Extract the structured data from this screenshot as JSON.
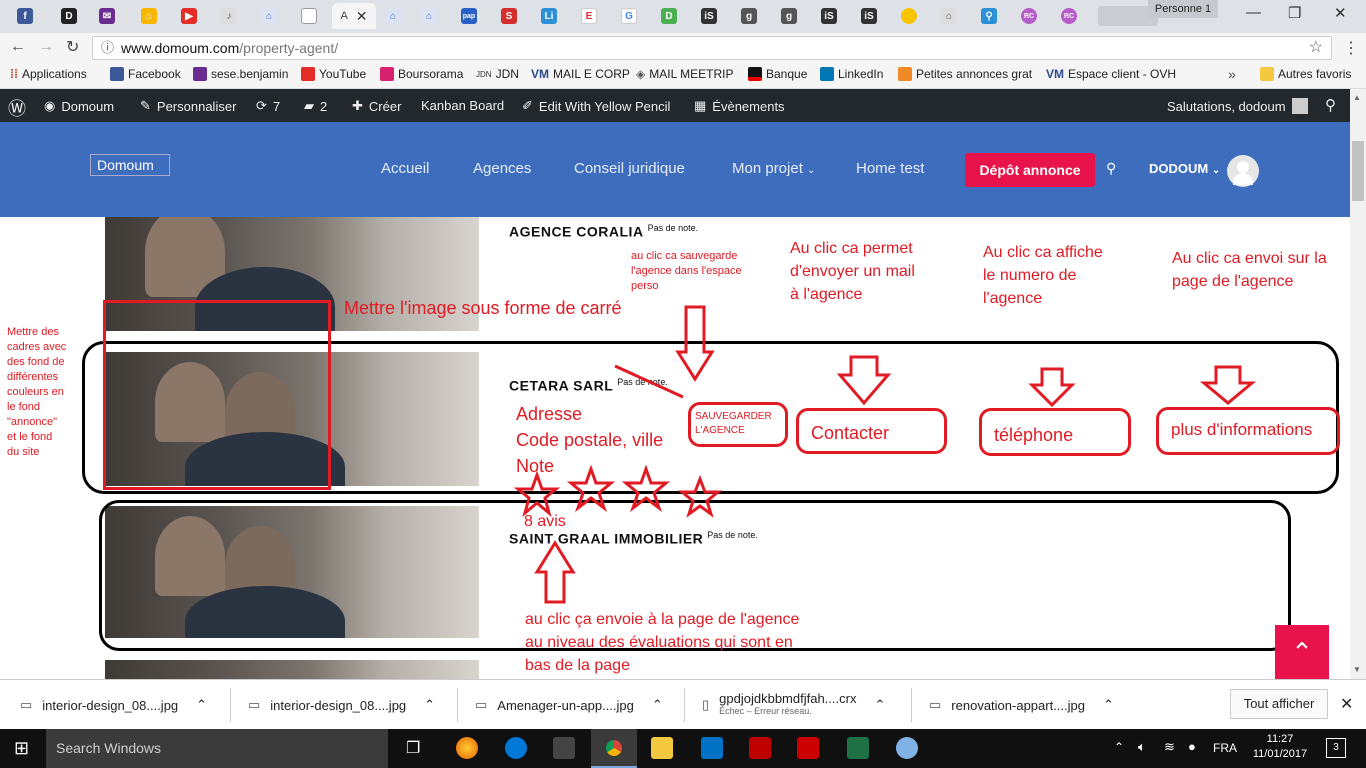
{
  "browser": {
    "profile": "Personne 1",
    "url_host": "www.domoum.com",
    "url_path": "/property-agent/",
    "active_tab_label": "A"
  },
  "bookmarks": [
    "Applications",
    "Facebook",
    "sese.benjamin",
    "YouTube",
    "Boursorama",
    "JDN",
    "MAIL E CORP",
    "MAIL MEETRIP",
    "Banque",
    "LinkedIn",
    "Petites annonces grat",
    "Espace client - OVH",
    "Autres favoris"
  ],
  "wp_admin": {
    "site": "Domoum",
    "customize": "Personnaliser",
    "updates": "7",
    "comments": "2",
    "new": "Créer",
    "kanban": "Kanban Board",
    "yellow_pencil": "Edit With Yellow Pencil",
    "events": "Évènements",
    "greeting": "Salutations, dodoum"
  },
  "site_header": {
    "logo_alt": "Domoum",
    "nav": [
      "Accueil",
      "Agences",
      "Conseil juridique",
      "Mon projet",
      "Home test"
    ],
    "cta": "Dépôt annonce",
    "user": "DODOUM"
  },
  "agencies": [
    {
      "name": "AGENCE CORALIA",
      "note": "Pas de note."
    },
    {
      "name": "CETARA SARL",
      "note": "Pas de note."
    },
    {
      "name": "SAINT GRAAL IMMOBILIER",
      "note": "Pas de note."
    }
  ],
  "annotations": {
    "left_note": [
      "Mettre des",
      "cadres avec",
      "des fond de",
      "différentes",
      "couleurs en",
      "le fond",
      "\"annonce\"",
      "et le fond",
      "du site"
    ],
    "square_image": "Mettre l'image sous forme de carré",
    "save_hint": [
      "au clic ca sauvegarde",
      "l'agence dans l'espace",
      "perso"
    ],
    "mail_hint": [
      "Au clic ca permet",
      "d'envoyer un mail",
      "à l'agence"
    ],
    "phone_hint": [
      "Au clic ca affiche",
      "le numero de",
      "l'agence"
    ],
    "info_hint": [
      "Au clic ca envoi sur la",
      "page de l'agence"
    ],
    "address": "Adresse",
    "postal": "Code postale, ville",
    "note": "Note",
    "reviews": "8 avis",
    "save_btn": [
      "SAUVEGARDER",
      "L'AGENCE"
    ],
    "contact_btn": "Contacter",
    "phone_btn": "téléphone",
    "info_btn": "plus d'informations",
    "reviews_hint": [
      "au clic ça envoie à la page de l'agence",
      "au niveau des évaluations qui sont en",
      "bas de la page"
    ]
  },
  "downloads": [
    {
      "name": "interior-design_08....jpg",
      "sub": ""
    },
    {
      "name": "interior-design_08....jpg",
      "sub": ""
    },
    {
      "name": "Amenager-un-app....jpg",
      "sub": ""
    },
    {
      "name": "gpdjojdkbbmdfjfah....crx",
      "sub": "Échec – Erreur réseau."
    },
    {
      "name": "renovation-appart....jpg",
      "sub": ""
    }
  ],
  "downloads_all": "Tout afficher",
  "taskbar": {
    "search": "Search Windows",
    "lang": "FRA",
    "time": "11:27",
    "date": "11/01/2017",
    "notif": "3"
  }
}
